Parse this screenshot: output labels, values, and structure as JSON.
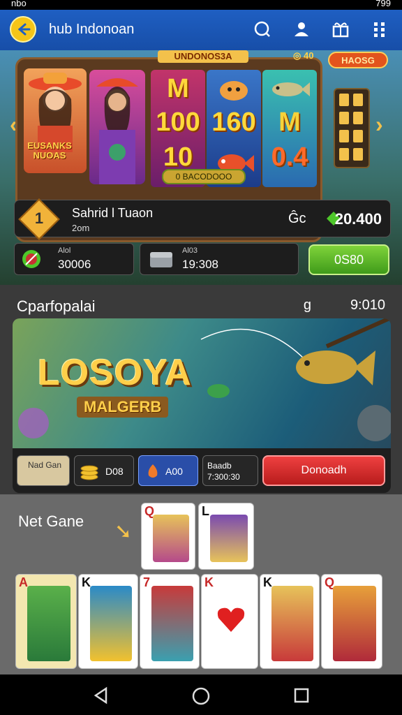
{
  "status_bar": {
    "left": "nbo",
    "right": "799"
  },
  "app_bar": {
    "title": "hub Indonoan"
  },
  "hero": {
    "reel_title": "UNDONOS3A",
    "coin_chip": "40",
    "bonus_pill": "HAOSG",
    "portrait_caption": "EUSANKS NUOAS",
    "reel_symbols": [
      [
        "M",
        "100",
        "10"
      ],
      [
        "M",
        "160",
        ""
      ],
      [
        "",
        "M",
        "0.4"
      ]
    ],
    "jackpot_chip": "0 BACODOOO",
    "player": {
      "level": "1",
      "name": "Sahrid l Tuaon",
      "sub": "2om",
      "balance_prefix": "Ĝc",
      "balance": "20.400"
    },
    "stats": [
      {
        "label": "Alol",
        "value": "30006"
      },
      {
        "label": "Al03",
        "value": "19:308"
      }
    ],
    "action_button": "0S80"
  },
  "section2": {
    "title": "Cparfopalai",
    "icon_glyph": "g",
    "right_value": "9:010",
    "banner_title": "LOSOYA",
    "banner_subtitle": "MALGERB",
    "chips": [
      {
        "text": "Nad Gan"
      },
      {
        "text": "D08"
      },
      {
        "text": "A00"
      },
      {
        "text": "Baadb 7:300:30"
      }
    ],
    "deposit_button": "Donoadh"
  },
  "section3": {
    "title": "Net Gane",
    "top_cards": [
      {
        "rank": "Q",
        "suit": "♦"
      },
      {
        "rank": "L",
        "suit": "♠"
      }
    ],
    "bottom_cards": [
      {
        "rank": "A",
        "suit": "♦"
      },
      {
        "rank": "K",
        "suit": "♣"
      },
      {
        "rank": "7",
        "suit": "♦"
      },
      {
        "rank": "K",
        "suit": "♥"
      },
      {
        "rank": "K",
        "suit": "♣"
      },
      {
        "rank": "Q",
        "suit": "♦"
      }
    ]
  },
  "colors": {
    "appbar": "#1f5fc2",
    "accent_gold": "#f5c518",
    "green": "#4ea823",
    "red": "#d32f2f"
  }
}
